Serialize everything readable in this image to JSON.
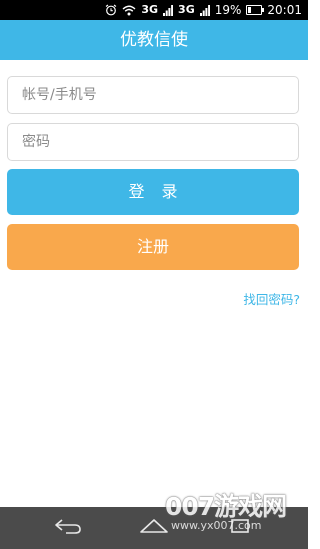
{
  "status_bar": {
    "network": "3G",
    "network2": "3G",
    "battery": "19%",
    "time": "20:01",
    "icons": [
      "alarm-icon",
      "wifi-icon",
      "signal-icon",
      "signal-icon",
      "battery-icon"
    ]
  },
  "header": {
    "title": "优教信使"
  },
  "login_form": {
    "account_placeholder": "帐号/手机号",
    "password_placeholder": "密码",
    "login_label": "登 录",
    "register_label": "注册",
    "forgot_label": "找回密码?"
  },
  "nav_bar": {
    "icons": [
      "back-icon",
      "home-icon",
      "recent-apps-icon"
    ]
  },
  "watermark": {
    "main": "007游戏网",
    "sub": "www.yx007.com"
  },
  "colors": {
    "primary": "#3fb7e7",
    "register": "#f9a84c",
    "nav_bar": "#4b4b4b",
    "status_bar": "#000000"
  }
}
